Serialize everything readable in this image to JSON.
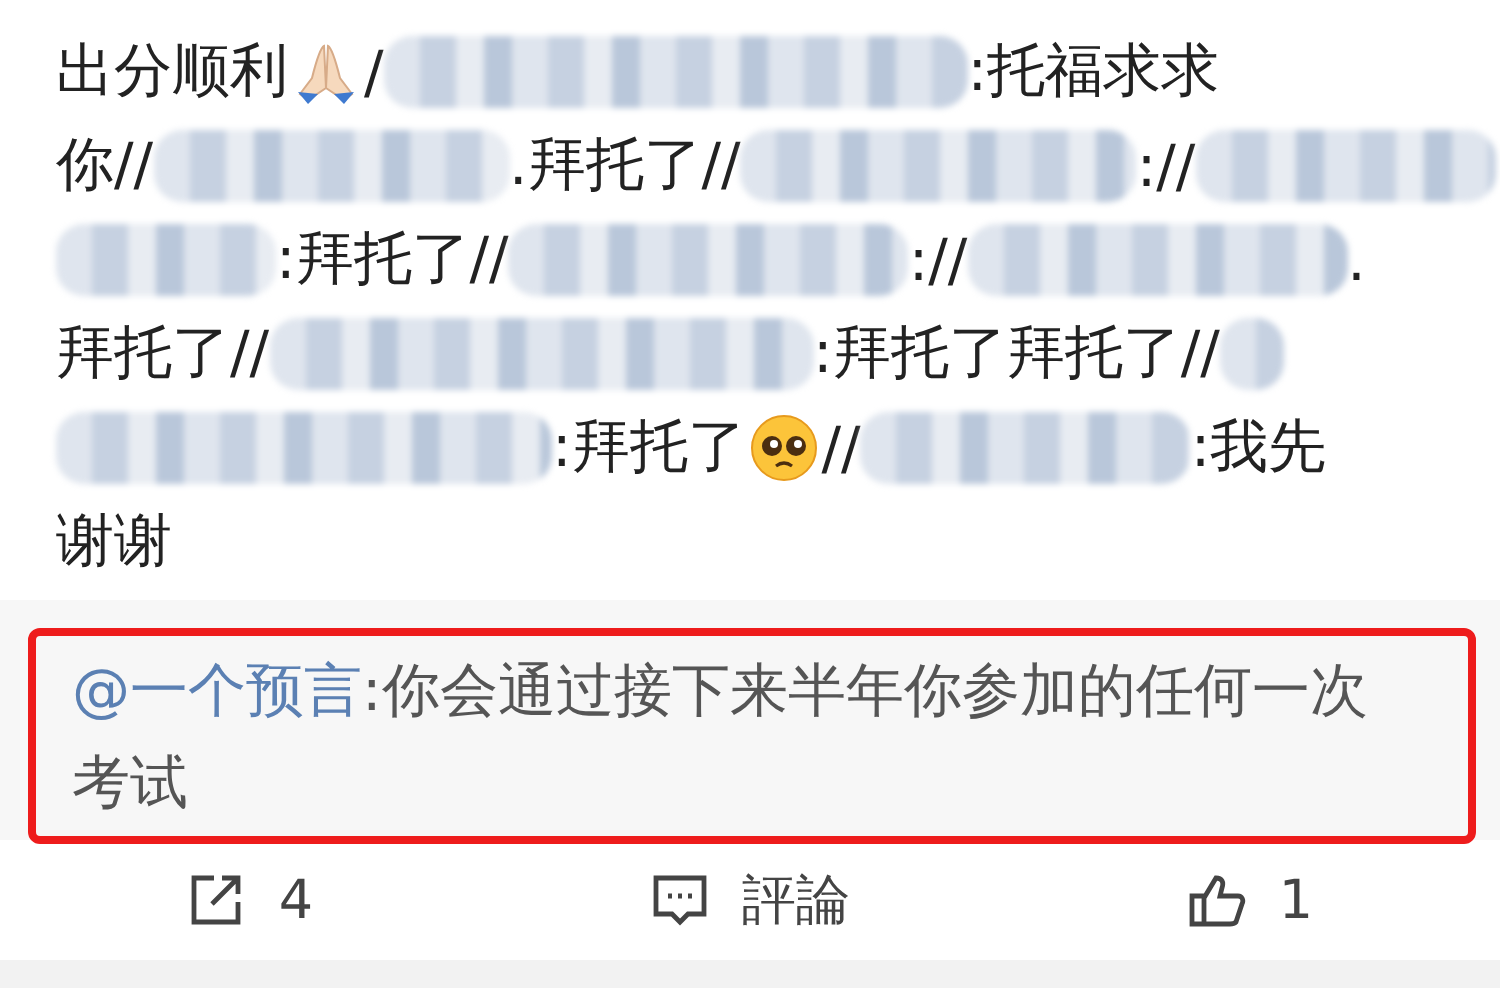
{
  "post": {
    "lines": [
      [
        {
          "kind": "text",
          "text": "出分顺利"
        },
        {
          "kind": "hands"
        },
        {
          "kind": "text",
          "text": "/"
        },
        {
          "kind": "redacted"
        },
        {
          "kind": "text",
          "text": ":托福求求"
        }
      ],
      [
        {
          "kind": "text",
          "text": "你//"
        },
        {
          "kind": "redacted"
        },
        {
          "kind": "text",
          "text": ".拜托了//"
        },
        {
          "kind": "redacted"
        },
        {
          "kind": "text",
          "text": ":/​/"
        },
        {
          "kind": "redacted"
        }
      ],
      [
        {
          "kind": "redacted"
        },
        {
          "kind": "text",
          "text": ":拜托了//"
        },
        {
          "kind": "redacted"
        },
        {
          "kind": "text",
          "text": "://"
        },
        {
          "kind": "redacted"
        },
        {
          "kind": "text",
          "text": "."
        }
      ],
      [
        {
          "kind": "text",
          "text": "拜托了//"
        },
        {
          "kind": "redacted"
        },
        {
          "kind": "text",
          "text": ":拜托了拜托了//"
        },
        {
          "kind": "redacted"
        }
      ],
      [
        {
          "kind": "redacted"
        },
        {
          "kind": "text",
          "text": ":拜托了"
        },
        {
          "kind": "face"
        },
        {
          "kind": "text",
          "text": "//"
        },
        {
          "kind": "redacted"
        },
        {
          "kind": "text",
          "text": ":我先"
        }
      ],
      [
        {
          "kind": "text",
          "text": "谢谢"
        }
      ]
    ]
  },
  "quote": {
    "mention": "@一个预言",
    "text": ":你会通过接下来半年你参加的任何一次考试"
  },
  "actions": [
    {
      "kind": "share",
      "label": "4"
    },
    {
      "kind": "comment",
      "label": "評論"
    },
    {
      "kind": "like",
      "label": "1"
    }
  ]
}
